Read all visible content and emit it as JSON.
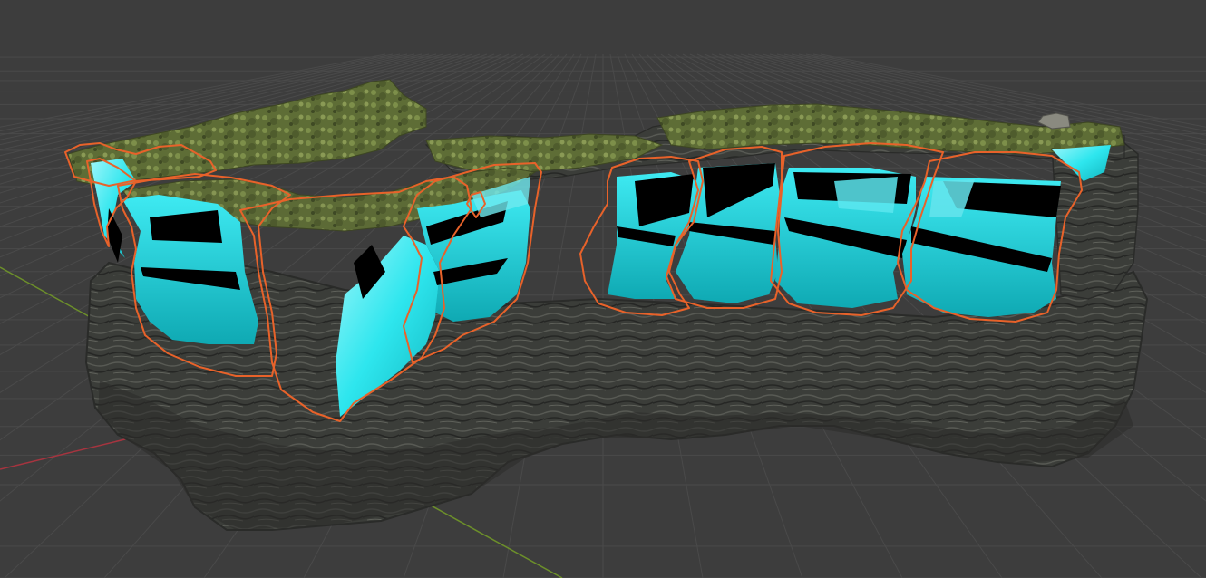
{
  "viewport": {
    "background_color": "#3d3d3d",
    "grid_color": "#4a4a4a",
    "axis_x_color": "#a6343f",
    "axis_y_color": "#6c8f2a"
  },
  "scene": {
    "rock_base_color": "#3a3c38",
    "rock_dark_color": "#2a2b29",
    "rock_light_color": "#6b6d66",
    "moss_color": "#6a7a3e",
    "moss_dark_color": "#4d5a2c",
    "cavity_color": "#2ee6ee",
    "cavity_shadow_color": "#0d9fa8",
    "void_color": "#000000",
    "selection_outline_color": "#e8622a",
    "selected_objects": [
      "cavity-outline-1",
      "cavity-outline-2",
      "cavity-outline-3",
      "cavity-outline-4",
      "cavity-outline-5",
      "cavity-outline-6",
      "cavity-outline-7",
      "cavity-outline-8",
      "cavity-outline-9"
    ]
  }
}
